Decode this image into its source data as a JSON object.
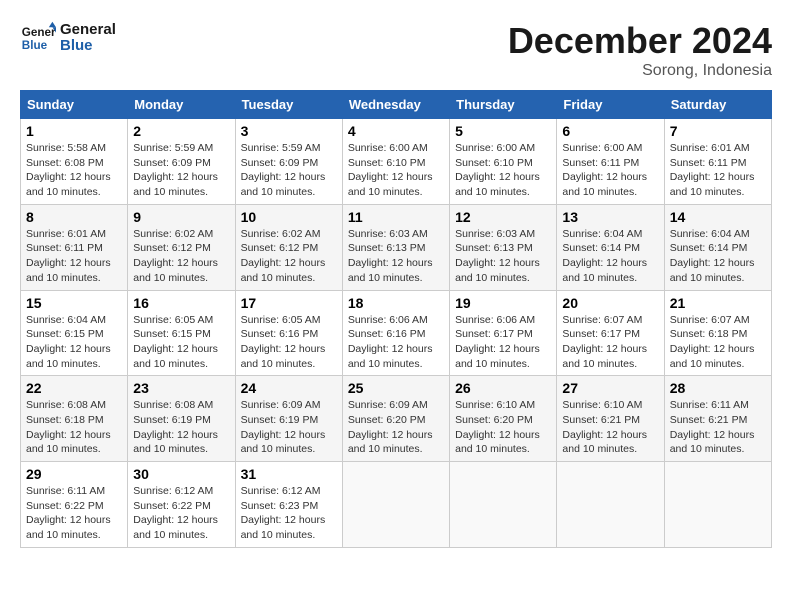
{
  "logo": {
    "line1": "General",
    "line2": "Blue"
  },
  "title": "December 2024",
  "subtitle": "Sorong, Indonesia",
  "headers": [
    "Sunday",
    "Monday",
    "Tuesday",
    "Wednesday",
    "Thursday",
    "Friday",
    "Saturday"
  ],
  "weeks": [
    [
      {
        "day": "1",
        "sunrise": "5:58 AM",
        "sunset": "6:08 PM",
        "daylight": "12 hours and 10 minutes."
      },
      {
        "day": "2",
        "sunrise": "5:59 AM",
        "sunset": "6:09 PM",
        "daylight": "12 hours and 10 minutes."
      },
      {
        "day": "3",
        "sunrise": "5:59 AM",
        "sunset": "6:09 PM",
        "daylight": "12 hours and 10 minutes."
      },
      {
        "day": "4",
        "sunrise": "6:00 AM",
        "sunset": "6:10 PM",
        "daylight": "12 hours and 10 minutes."
      },
      {
        "day": "5",
        "sunrise": "6:00 AM",
        "sunset": "6:10 PM",
        "daylight": "12 hours and 10 minutes."
      },
      {
        "day": "6",
        "sunrise": "6:00 AM",
        "sunset": "6:11 PM",
        "daylight": "12 hours and 10 minutes."
      },
      {
        "day": "7",
        "sunrise": "6:01 AM",
        "sunset": "6:11 PM",
        "daylight": "12 hours and 10 minutes."
      }
    ],
    [
      {
        "day": "8",
        "sunrise": "6:01 AM",
        "sunset": "6:11 PM",
        "daylight": "12 hours and 10 minutes."
      },
      {
        "day": "9",
        "sunrise": "6:02 AM",
        "sunset": "6:12 PM",
        "daylight": "12 hours and 10 minutes."
      },
      {
        "day": "10",
        "sunrise": "6:02 AM",
        "sunset": "6:12 PM",
        "daylight": "12 hours and 10 minutes."
      },
      {
        "day": "11",
        "sunrise": "6:03 AM",
        "sunset": "6:13 PM",
        "daylight": "12 hours and 10 minutes."
      },
      {
        "day": "12",
        "sunrise": "6:03 AM",
        "sunset": "6:13 PM",
        "daylight": "12 hours and 10 minutes."
      },
      {
        "day": "13",
        "sunrise": "6:04 AM",
        "sunset": "6:14 PM",
        "daylight": "12 hours and 10 minutes."
      },
      {
        "day": "14",
        "sunrise": "6:04 AM",
        "sunset": "6:14 PM",
        "daylight": "12 hours and 10 minutes."
      }
    ],
    [
      {
        "day": "15",
        "sunrise": "6:04 AM",
        "sunset": "6:15 PM",
        "daylight": "12 hours and 10 minutes."
      },
      {
        "day": "16",
        "sunrise": "6:05 AM",
        "sunset": "6:15 PM",
        "daylight": "12 hours and 10 minutes."
      },
      {
        "day": "17",
        "sunrise": "6:05 AM",
        "sunset": "6:16 PM",
        "daylight": "12 hours and 10 minutes."
      },
      {
        "day": "18",
        "sunrise": "6:06 AM",
        "sunset": "6:16 PM",
        "daylight": "12 hours and 10 minutes."
      },
      {
        "day": "19",
        "sunrise": "6:06 AM",
        "sunset": "6:17 PM",
        "daylight": "12 hours and 10 minutes."
      },
      {
        "day": "20",
        "sunrise": "6:07 AM",
        "sunset": "6:17 PM",
        "daylight": "12 hours and 10 minutes."
      },
      {
        "day": "21",
        "sunrise": "6:07 AM",
        "sunset": "6:18 PM",
        "daylight": "12 hours and 10 minutes."
      }
    ],
    [
      {
        "day": "22",
        "sunrise": "6:08 AM",
        "sunset": "6:18 PM",
        "daylight": "12 hours and 10 minutes."
      },
      {
        "day": "23",
        "sunrise": "6:08 AM",
        "sunset": "6:19 PM",
        "daylight": "12 hours and 10 minutes."
      },
      {
        "day": "24",
        "sunrise": "6:09 AM",
        "sunset": "6:19 PM",
        "daylight": "12 hours and 10 minutes."
      },
      {
        "day": "25",
        "sunrise": "6:09 AM",
        "sunset": "6:20 PM",
        "daylight": "12 hours and 10 minutes."
      },
      {
        "day": "26",
        "sunrise": "6:10 AM",
        "sunset": "6:20 PM",
        "daylight": "12 hours and 10 minutes."
      },
      {
        "day": "27",
        "sunrise": "6:10 AM",
        "sunset": "6:21 PM",
        "daylight": "12 hours and 10 minutes."
      },
      {
        "day": "28",
        "sunrise": "6:11 AM",
        "sunset": "6:21 PM",
        "daylight": "12 hours and 10 minutes."
      }
    ],
    [
      {
        "day": "29",
        "sunrise": "6:11 AM",
        "sunset": "6:22 PM",
        "daylight": "12 hours and 10 minutes."
      },
      {
        "day": "30",
        "sunrise": "6:12 AM",
        "sunset": "6:22 PM",
        "daylight": "12 hours and 10 minutes."
      },
      {
        "day": "31",
        "sunrise": "6:12 AM",
        "sunset": "6:23 PM",
        "daylight": "12 hours and 10 minutes."
      },
      null,
      null,
      null,
      null
    ]
  ]
}
